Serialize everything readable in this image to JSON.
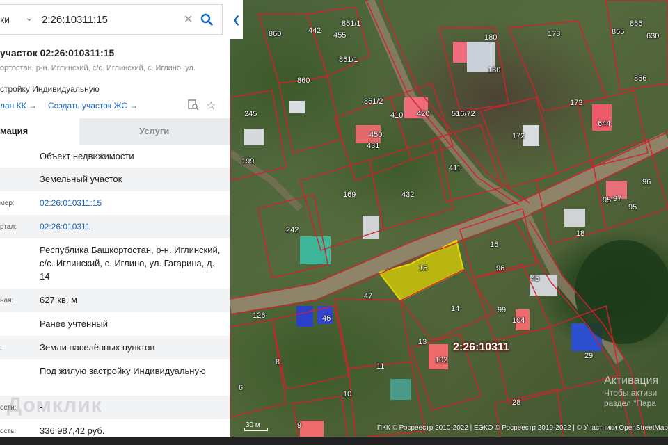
{
  "search": {
    "type_label": "ки",
    "value": "2:26:10311:15"
  },
  "object": {
    "title": "участок 02:26:010311:15",
    "address_short": "ортостан, р-н. Иглинский, с/с. Иглинский, с. Иглино, ул.",
    "purpose_short": "стройку Индивидуальную",
    "link_plan": "лан КК →",
    "link_create": "Создать участок ЖС →"
  },
  "tabs": {
    "info": "мация",
    "services": "Услуги"
  },
  "rows": [
    {
      "key": "",
      "value": "Объект недвижимости"
    },
    {
      "key": "",
      "value": "Земельный участок"
    },
    {
      "key": "мер:",
      "value": "02:26:010311:15"
    },
    {
      "key": "ртал:",
      "value": "02:26:010311"
    },
    {
      "key": "",
      "value": "Республика Башкортостан, р-н. Иглинский, с/с. Иглинский, с. Иглино, ул. Гагарина, д. 14"
    },
    {
      "key": "ная:",
      "value": "627 кв. м"
    },
    {
      "key": "",
      "value": "Ранее учтенный"
    },
    {
      "key": ":",
      "value": "Земли населённых пунктов"
    },
    {
      "key": "",
      "value": "Под жилую застройку Индивидуальную"
    },
    {
      "key": "ости:",
      "value": "-"
    },
    {
      "key": "ость:",
      "value": "336 987,42 руб."
    }
  ],
  "watermark": "Домклик",
  "map": {
    "quarter_label": "2:26:10311",
    "selected_parcel": "15",
    "parcel_labels": [
      "860",
      "442",
      "455",
      "861/1",
      "861/1",
      "860",
      "180",
      "173",
      "865",
      "866",
      "630",
      "180",
      "866",
      "245",
      "861/2",
      "410",
      "420",
      "516/72",
      "173",
      "644",
      "450",
      "431",
      "199",
      "172",
      "411",
      "169",
      "432",
      "96",
      "95",
      "97",
      "95",
      "242",
      "18",
      "16",
      "15",
      "96",
      "45",
      "47",
      "99",
      "104",
      "46",
      "14",
      "13",
      "102",
      "29",
      "8",
      "11",
      "10",
      "6",
      "9",
      "28",
      "126"
    ],
    "scale_label": "30 м",
    "attribution": "ПКК © Росреестр 2010-2022 | ЕЭКО © Росреестр 2019-2022 | © Участники OpenStreetMap",
    "activation_title": "Активация",
    "activation_line1": "Чтобы активи",
    "activation_line2": "раздел \"Пара"
  },
  "colors": {
    "boundary": "#d4202a",
    "selected_fill": "#e6d800",
    "link": "#1565c0"
  }
}
